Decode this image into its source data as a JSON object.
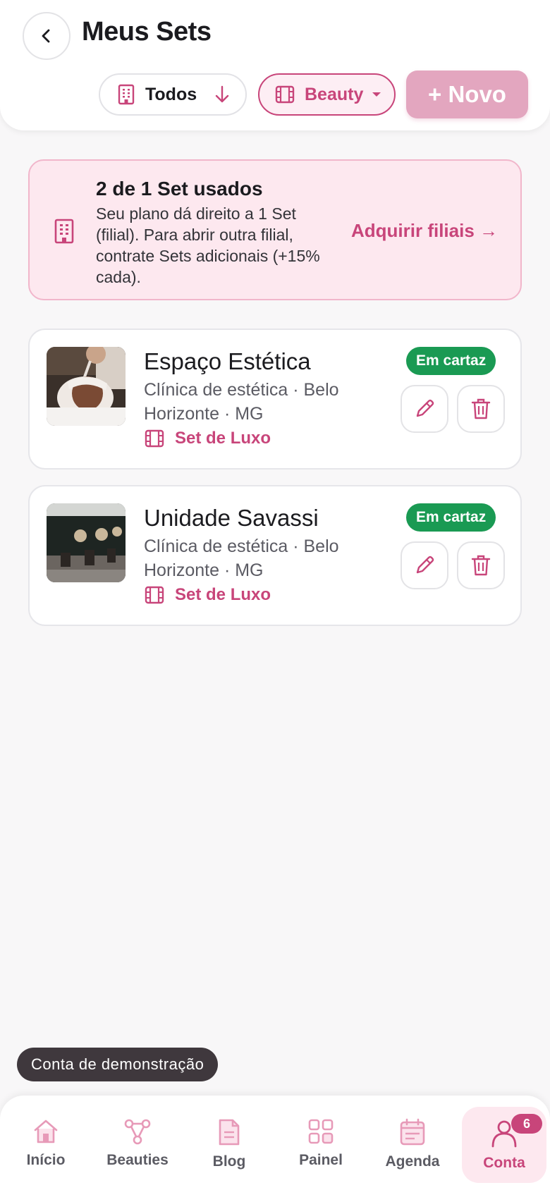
{
  "header": {
    "title": "Meus Sets",
    "filters": {
      "todos_label": "Todos",
      "beauty_label": "Beauty"
    },
    "new_button_label": "+ Novo"
  },
  "banner": {
    "title": "2 de 1 Set usados",
    "text": "Seu plano dá direito a 1 Set (filial). Para abrir outra filial, contrate Sets adicionais (+15% cada).",
    "link_label": "Adquirir filiais →"
  },
  "sets": [
    {
      "name": "Espaço Estética",
      "subtitle": "Clínica de estética · Belo Horizonte · MG",
      "set_label": "Set de Luxo",
      "status": "Em cartaz"
    },
    {
      "name": "Unidade Savassi",
      "subtitle": "Clínica de estética · Belo Horizonte · MG",
      "set_label": "Set de Luxo",
      "status": "Em cartaz"
    }
  ],
  "demo_label": "Conta de demonstração",
  "bottom_nav": {
    "items": [
      {
        "label": "Início",
        "icon": "home-icon"
      },
      {
        "label": "Beauties",
        "icon": "network-icon"
      },
      {
        "label": "Blog",
        "icon": "document-icon"
      },
      {
        "label": "Painel",
        "icon": "grid-icon"
      },
      {
        "label": "Agenda",
        "icon": "calendar-icon"
      },
      {
        "label": "Conta",
        "icon": "user-icon",
        "badge": "6",
        "active": true
      }
    ]
  },
  "colors": {
    "accent": "#c8457a",
    "accent_light": "#fde8ef",
    "status_green": "#1a9a53",
    "new_button_bg": "#e3a6bf"
  }
}
